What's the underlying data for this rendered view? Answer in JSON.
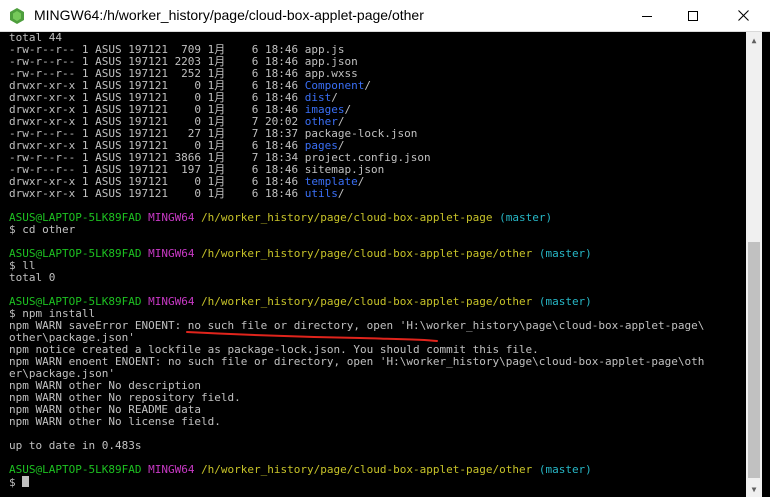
{
  "window": {
    "title": "MINGW64:/h/worker_history/page/cloud-box-applet-page/other",
    "buttons": {
      "minimize": "—",
      "maximize": "□",
      "close": "✕"
    }
  },
  "terminal": {
    "lines": [
      [
        {
          "t": "total 44",
          "c": "white"
        }
      ],
      [
        {
          "t": "-rw-r--r-- 1 ASUS 197121  709 1月    6 18:46 app.js",
          "c": "white"
        }
      ],
      [
        {
          "t": "-rw-r--r-- 1 ASUS 197121 2203 1月    6 18:46 app.json",
          "c": "white"
        }
      ],
      [
        {
          "t": "-rw-r--r-- 1 ASUS 197121  252 1月    6 18:46 app.wxss",
          "c": "white"
        }
      ],
      [
        {
          "t": "drwxr-xr-x 1 ASUS 197121    0 1月    6 18:46 ",
          "c": "white"
        },
        {
          "t": "Component",
          "c": "blue"
        },
        {
          "t": "/",
          "c": "white"
        }
      ],
      [
        {
          "t": "drwxr-xr-x 1 ASUS 197121    0 1月    6 18:46 ",
          "c": "white"
        },
        {
          "t": "dist",
          "c": "blue"
        },
        {
          "t": "/",
          "c": "white"
        }
      ],
      [
        {
          "t": "drwxr-xr-x 1 ASUS 197121    0 1月    6 18:46 ",
          "c": "white"
        },
        {
          "t": "images",
          "c": "blue"
        },
        {
          "t": "/",
          "c": "white"
        }
      ],
      [
        {
          "t": "drwxr-xr-x 1 ASUS 197121    0 1月    7 20:02 ",
          "c": "white"
        },
        {
          "t": "other",
          "c": "blue"
        },
        {
          "t": "/",
          "c": "white"
        }
      ],
      [
        {
          "t": "-rw-r--r-- 1 ASUS 197121   27 1月    7 18:37 package-lock.json",
          "c": "white"
        }
      ],
      [
        {
          "t": "drwxr-xr-x 1 ASUS 197121    0 1月    6 18:46 ",
          "c": "white"
        },
        {
          "t": "pages",
          "c": "blue"
        },
        {
          "t": "/",
          "c": "white"
        }
      ],
      [
        {
          "t": "-rw-r--r-- 1 ASUS 197121 3866 1月    7 18:34 project.config.json",
          "c": "white"
        }
      ],
      [
        {
          "t": "-rw-r--r-- 1 ASUS 197121  197 1月    6 18:46 sitemap.json",
          "c": "white"
        }
      ],
      [
        {
          "t": "drwxr-xr-x 1 ASUS 197121    0 1月    6 18:46 ",
          "c": "white"
        },
        {
          "t": "template",
          "c": "blue"
        },
        {
          "t": "/",
          "c": "white"
        }
      ],
      [
        {
          "t": "drwxr-xr-x 1 ASUS 197121    0 1月    6 18:46 ",
          "c": "white"
        },
        {
          "t": "utils",
          "c": "blue"
        },
        {
          "t": "/",
          "c": "white"
        }
      ],
      [
        {
          "t": "",
          "c": "white"
        }
      ],
      [
        {
          "t": "ASUS@LAPTOP-5LK89FAD ",
          "c": "green"
        },
        {
          "t": "MINGW64 ",
          "c": "magenta"
        },
        {
          "t": "/h/worker_history/page/cloud-box-applet-page",
          "c": "yellow"
        },
        {
          "t": " (master)",
          "c": "cyan"
        }
      ],
      [
        {
          "t": "$ cd other",
          "c": "white"
        }
      ],
      [
        {
          "t": "",
          "c": "white"
        }
      ],
      [
        {
          "t": "ASUS@LAPTOP-5LK89FAD ",
          "c": "green"
        },
        {
          "t": "MINGW64 ",
          "c": "magenta"
        },
        {
          "t": "/h/worker_history/page/cloud-box-applet-page/other",
          "c": "yellow"
        },
        {
          "t": " (master)",
          "c": "cyan"
        }
      ],
      [
        {
          "t": "$ ll",
          "c": "white"
        }
      ],
      [
        {
          "t": "total 0",
          "c": "white"
        }
      ],
      [
        {
          "t": "",
          "c": "white"
        }
      ],
      [
        {
          "t": "ASUS@LAPTOP-5LK89FAD ",
          "c": "green"
        },
        {
          "t": "MINGW64 ",
          "c": "magenta"
        },
        {
          "t": "/h/worker_history/page/cloud-box-applet-page/other",
          "c": "yellow"
        },
        {
          "t": " (master)",
          "c": "cyan"
        }
      ],
      [
        {
          "t": "$ npm install",
          "c": "white"
        }
      ],
      [
        {
          "t": "npm WARN saveError ENOENT: no such file or directory, open 'H:\\worker_history\\page\\cloud-box-applet-page\\",
          "c": "white"
        }
      ],
      [
        {
          "t": "other\\package.json'",
          "c": "white"
        }
      ],
      [
        {
          "t": "npm notice created a lockfile as package-lock.json. You should commit this file.",
          "c": "white"
        }
      ],
      [
        {
          "t": "npm WARN enoent ENOENT: no such file or directory, open 'H:\\worker_history\\page\\cloud-box-applet-page\\oth",
          "c": "white"
        }
      ],
      [
        {
          "t": "er\\package.json'",
          "c": "white"
        }
      ],
      [
        {
          "t": "npm WARN other No description",
          "c": "white"
        }
      ],
      [
        {
          "t": "npm WARN other No repository field.",
          "c": "white"
        }
      ],
      [
        {
          "t": "npm WARN other No README data",
          "c": "white"
        }
      ],
      [
        {
          "t": "npm WARN other No license field.",
          "c": "white"
        }
      ],
      [
        {
          "t": "",
          "c": "white"
        }
      ],
      [
        {
          "t": "up to date in 0.483s",
          "c": "white"
        }
      ],
      [
        {
          "t": "",
          "c": "white"
        }
      ],
      [
        {
          "t": "ASUS@LAPTOP-5LK89FAD ",
          "c": "green"
        },
        {
          "t": "MINGW64 ",
          "c": "magenta"
        },
        {
          "t": "/h/worker_history/page/cloud-box-applet-page/other",
          "c": "yellow"
        },
        {
          "t": " (master)",
          "c": "cyan"
        }
      ],
      [
        {
          "t": "$ ",
          "c": "white"
        }
      ]
    ],
    "colors": {
      "background": "#000000",
      "text": "#c0c0c0",
      "user_host": "#1dc121",
      "mingw": "#c839c5",
      "path": "#c7c329",
      "branch": "#27b7c6",
      "directory": "#3a6ff6",
      "annotation": "#e0241c"
    }
  }
}
